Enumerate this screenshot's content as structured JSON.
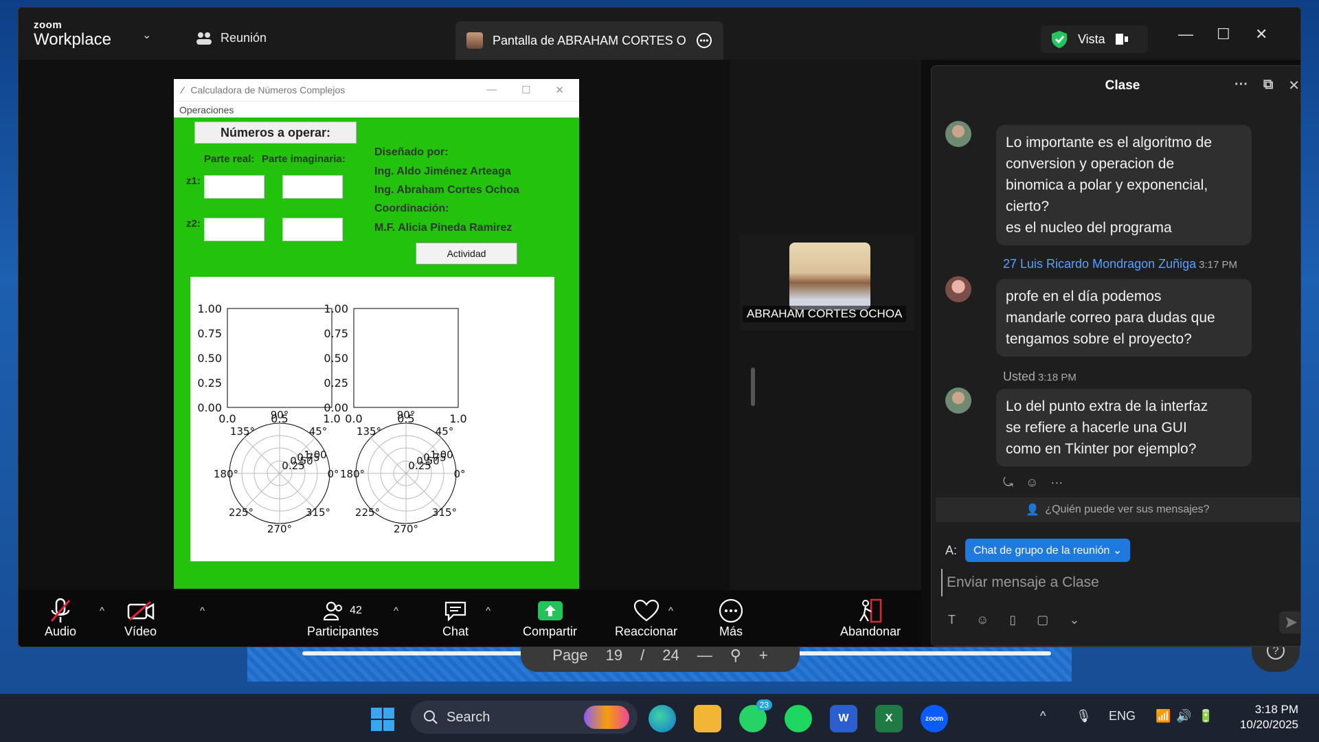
{
  "window": {
    "brand_top": "zoom",
    "brand_bottom": "Workplace",
    "meeting_label": "Reunión",
    "share_tab_title": "Pantalla de ABRAHAM CORTES O",
    "view_label": "Vista"
  },
  "shared_app": {
    "title": "Calculadora de Números Complejos",
    "menu": "Operaciones",
    "header_button": "Números a operar:",
    "real_label": "Parte real:",
    "imag_label": "Parte imaginaria:",
    "z1_label": "z1:",
    "z2_label": "z2:",
    "credits": [
      "Diseñado por:",
      "Ing. Aldo Jiménez Arteaga",
      "Ing. Abraham Cortes Ochoa",
      "Coordinación:",
      "M.F. Alicia Pineda Ramirez"
    ],
    "activity_button": "Actividad",
    "y_ticks": [
      "1.00",
      "0.75",
      "0.50",
      "0.25",
      "0.00"
    ],
    "x_ticks": [
      "0.0",
      "0.5",
      "1.0"
    ],
    "polar_labels": {
      "deg90": "90°",
      "deg45": "45°",
      "deg135": "135°",
      "deg180": "180°",
      "deg0": "0°",
      "deg225": "225°",
      "deg315": "315°",
      "deg270": "270°",
      "r1": "1.00",
      "r075": "0.75",
      "r050": "0.50",
      "r025": "0.25"
    }
  },
  "video": {
    "participant_name": "ABRAHAM CORTES OCHOA"
  },
  "toolbar": {
    "audio": "Audio",
    "video": "Vídeo",
    "participants": "Participantes",
    "participants_count": "42",
    "chat": "Chat",
    "share": "Compartir",
    "react": "Reaccionar",
    "more": "Más",
    "leave": "Abandonar"
  },
  "chat": {
    "title": "Clase",
    "messages": [
      {
        "text_lines": [
          "Lo importante es el algoritmo de",
          "conversion y operacion de",
          "binomica a polar y exponencial,",
          "cierto?",
          "es el nucleo del programa"
        ]
      },
      {
        "sender": "27 Luis Ricardo Mondragon Zuñiga",
        "time": "3:17 PM",
        "text_lines": [
          "profe en el día podemos",
          "mandarle correo para dudas que",
          "tengamos sobre el proyecto?"
        ]
      },
      {
        "sender": "Usted",
        "time": "3:18 PM",
        "text_lines": [
          "Lo del punto extra de la interfaz",
          "se refiere a hacerle una GUI",
          "como en Tkinter por ejemplo?"
        ]
      }
    ],
    "who_can_see": "¿Quién puede ver sus mensajes?",
    "to_label": "A:",
    "to_target": "Chat de grupo de la reunión",
    "input_placeholder": "Enviar mensaje a Clase"
  },
  "pdf_viewer": {
    "page_label": "Page",
    "page_current": "19",
    "page_sep": "/",
    "page_total": "24"
  },
  "taskbar": {
    "search_placeholder": "Search",
    "whatsapp_badge": "23",
    "lang": "ENG",
    "time": "3:18 PM",
    "date": "10/20/2025"
  },
  "colors": {
    "tk_green": "#22c20d",
    "chat_link": "#5aa0ff",
    "share_green": "#21c35a",
    "zoom_blue": "#0b5cff"
  }
}
